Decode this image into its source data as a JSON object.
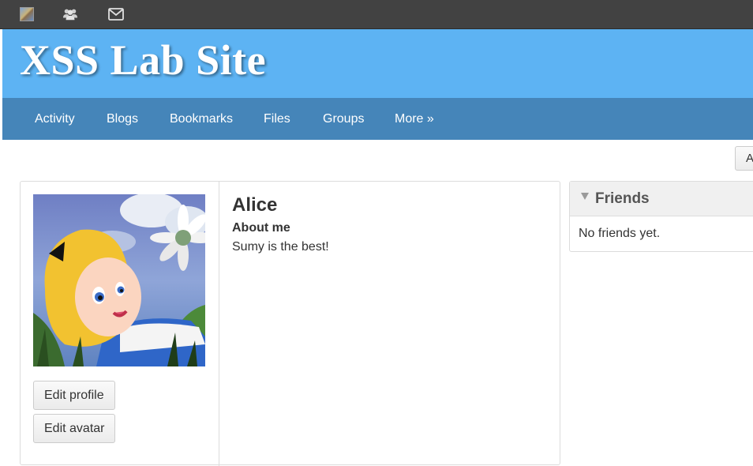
{
  "topbar": {
    "items": [
      {
        "icon": "user-avatar-icon"
      },
      {
        "icon": "friends-icon"
      },
      {
        "icon": "mail-icon"
      }
    ]
  },
  "header": {
    "site_title": "XSS Lab Site",
    "color": "#5db3f3"
  },
  "nav": {
    "color": "#4585b9",
    "items": [
      {
        "label": "Activity"
      },
      {
        "label": "Blogs"
      },
      {
        "label": "Bookmarks"
      },
      {
        "label": "Files"
      },
      {
        "label": "Groups"
      },
      {
        "label": "More »"
      }
    ]
  },
  "toolbar": {
    "clipped_button_label": "A"
  },
  "profile": {
    "name": "Alice",
    "about_label": "About me",
    "about_text": "Sumy is the best!",
    "buttons": {
      "edit_profile": "Edit profile",
      "edit_avatar": "Edit avatar"
    }
  },
  "friends": {
    "title": "Friends",
    "empty_text": "No friends yet."
  }
}
